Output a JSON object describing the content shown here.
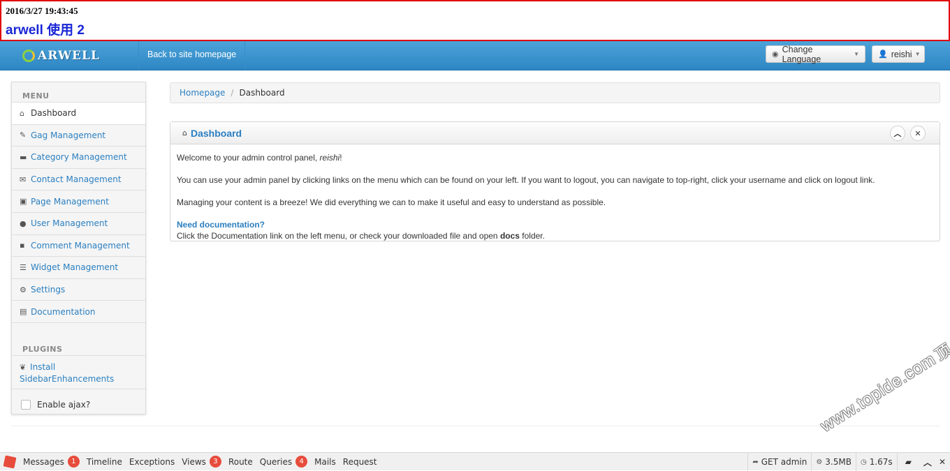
{
  "banner": {
    "timestamp": "2016/3/27 19:43:45",
    "title": "arwell 使用 2"
  },
  "navbar": {
    "logo_text": "ARWELL",
    "back_link": "Back to site homepage",
    "change_language": "Change Language",
    "username": "reishi"
  },
  "sidebar": {
    "menu_header": "MENU",
    "items": [
      {
        "label": "Dashboard",
        "icon": "home-icon",
        "active": true
      },
      {
        "label": "Gag Management",
        "icon": "pencil-icon"
      },
      {
        "label": "Category Management",
        "icon": "folder-open-icon"
      },
      {
        "label": "Contact Management",
        "icon": "envelope-icon"
      },
      {
        "label": "Page Management",
        "icon": "briefcase-icon"
      },
      {
        "label": "User Management",
        "icon": "user-icon"
      },
      {
        "label": "Comment Management",
        "icon": "comment-icon"
      },
      {
        "label": "Widget Management",
        "icon": "list-icon"
      },
      {
        "label": "Settings",
        "icon": "cog-icon"
      },
      {
        "label": "Documentation",
        "icon": "book-icon"
      }
    ],
    "plugins_header": "PLUGINS",
    "plugin_item_line1": "Install",
    "plugin_item_line2": "SidebarEnhancements",
    "ajax_label": "Enable ajax?"
  },
  "breadcrumb": {
    "home": "Homepage",
    "separator": "/",
    "current": "Dashboard"
  },
  "panel": {
    "title": "Dashboard",
    "welcome_prefix": "Welcome to your admin control panel, ",
    "welcome_user": "reishi",
    "welcome_suffix": "!",
    "instructions": "You can use your admin panel by clicking links on the menu which can be found on your left. If you want to logout, you can navigate to top-right, click your username and click on logout link.",
    "breeze": "Managing your content is a breeze! We did everything we can to make it useful and easy to understand as possible.",
    "need_doc": "Need documentation?",
    "doc_prefix": "Click the Documentation link on the left menu, or check your downloaded file and open ",
    "doc_bold": "docs",
    "doc_suffix": " folder."
  },
  "debugbar": {
    "tabs": [
      {
        "label": "Messages",
        "badge": "1"
      },
      {
        "label": "Timeline"
      },
      {
        "label": "Exceptions"
      },
      {
        "label": "Views",
        "badge": "3"
      },
      {
        "label": "Route"
      },
      {
        "label": "Queries",
        "badge": "4"
      },
      {
        "label": "Mails"
      },
      {
        "label": "Request"
      }
    ],
    "request": "GET admin",
    "memory": "3.5MB",
    "time": "1.67s"
  },
  "watermark": {
    "text": "www.topide.com",
    "cn": "顶点网"
  },
  "colors": {
    "accent": "#2b7fc0",
    "navbar": "#3a93cf",
    "badge": "#e74c3c",
    "banner_border": "#e00000"
  }
}
